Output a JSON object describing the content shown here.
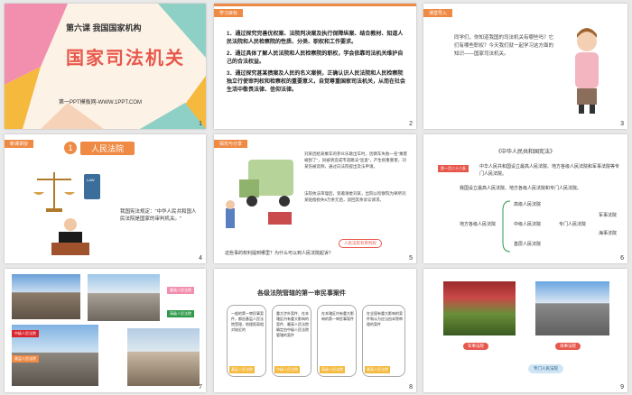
{
  "slides": [
    {
      "num": "1",
      "lesson": "第六课  我国国家机构",
      "title": "国家司法机关",
      "footer": "第一PPT模板网-WWW.1PPT.COM"
    },
    {
      "num": "2",
      "tag": "学习目标",
      "lines": [
        "1．通过探究完善优权案、法院判决案及执行保障纵案、结合教材、知道人民法院和人民检察院的性质、分类、职权和工作要求。",
        "2．通过具体了解人民法院和人民检察院的职权，学会依靠司法机关维护自己的合法权益。",
        "3．通过探究甚某债案及人民的名义案例，正确认识人民法院和人民检察院独立行使审判权和检察权的重要意义，自觉尊重国家司法机关，从而在社会生活中敬畏法律、信仰法律。"
      ]
    },
    {
      "num": "3",
      "tag": "课堂导入",
      "text": "同学们，你知道我国的司法机关有哪些吗？它们有哪些职权？今天我们就一起学习这方面的知识——国家司法机关。"
    },
    {
      "num": "4",
      "tag": "新课讲授",
      "heading_num": "1",
      "heading": "人民法院",
      "book": "LAW",
      "quote": "我国宪法规定：\"中华人民共和国人民法院是国家的审判机关。\""
    },
    {
      "num": "5",
      "tag": "探究与分享",
      "text": "刘某因给某乘车的参众乐歌出车时，因倒车失败一名\"乘客被刮了\"，同被请造成市道路法\"宣查\"，产生很重重害，刘某伤被谎称，通过向法院提出及法申请。",
      "text2": "法院依法审理后，受邀请委刘某，出院以检察院为律所刘某赔偿损失5万余元后，驳回其余诉讼请求。",
      "label": "人民法院有审判权",
      "question": "这些事的权利提到哪里？为什么可以到人民法院起诉？"
    },
    {
      "num": "6",
      "head": "《中华人民共和国宪法》",
      "tag": "第一百二十八条",
      "intro": "中华人民共和国设立最高人民法院、地方各级人民法院和军事法院等专门人民法院。",
      "struct": "我国设立最高人民法院、地方各级人民法院和专门人民法院。",
      "root": "地方各级人民法院",
      "branches": [
        "高级人民法院",
        "中级人民法院",
        "基层人民法院"
      ],
      "special": "专门人民法院",
      "special_kids": [
        "军事法院",
        "海事法院"
      ]
    },
    {
      "num": "7",
      "labels": [
        "最高人民法院",
        "高级人民法院",
        "中级人民法院",
        "基层人民法院"
      ]
    },
    {
      "num": "8",
      "title": "各级法院管辖的第一审民事案件",
      "cols": [
        {
          "text": "一般的第一审民事案件，都由基层人民法院受理，地理距离相对较近的",
          "label": "基层人民法院"
        },
        {
          "text": "重大涉外案件、在本辖区内有重大影响的案件、最高人民法院确定由中级人民法院管辖的案件",
          "label": "中级人民法院"
        },
        {
          "text": "在本辖区内有重大影响的第一审民事案件",
          "label": "高级人民法院"
        },
        {
          "text": "在全国有重大影响的案件和认为应当由本院审理的案件",
          "label": "最高人民法院"
        }
      ]
    },
    {
      "num": "9",
      "labels": [
        "军事法院",
        "海事法院"
      ],
      "badge": "专门人民法院"
    }
  ],
  "colors": {
    "orange": "#ef8a44",
    "pink": "#f28fae",
    "yellow": "#f5b93d",
    "green": "#2f9a4a",
    "red": "#d9232d"
  }
}
